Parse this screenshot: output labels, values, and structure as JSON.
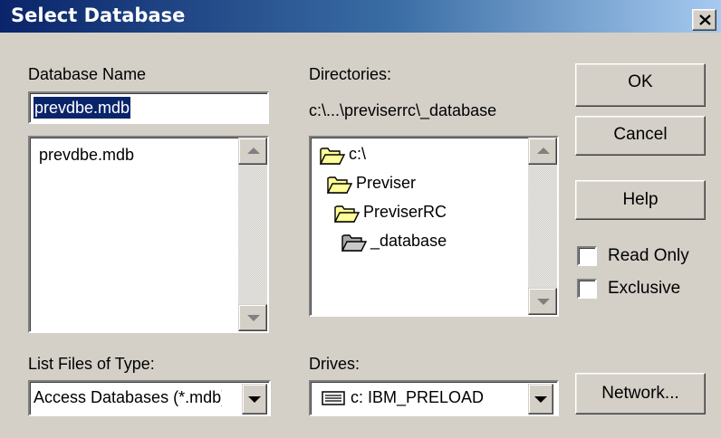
{
  "window": {
    "title": "Select Database",
    "close_symbol": "×"
  },
  "database_name": {
    "label": "Database Name",
    "value": "prevdbe.mdb",
    "files": [
      "prevdbe.mdb"
    ]
  },
  "directories": {
    "label": "Directories:",
    "current_path": "c:\\...\\previserrc\\_database",
    "items": [
      {
        "name": "c:\\",
        "icon": "open-folder-icon"
      },
      {
        "name": "Previser",
        "icon": "open-folder-icon"
      },
      {
        "name": "PreviserRC",
        "icon": "open-folder-icon"
      },
      {
        "name": "_database",
        "icon": "open-folder-icon"
      }
    ]
  },
  "file_type": {
    "label": "List Files of Type:",
    "value": "Access Databases (*.mdb)"
  },
  "drives": {
    "label": "Drives:",
    "value": "c: IBM_PRELOAD",
    "icon": "hard-drive-icon"
  },
  "buttons": {
    "ok": "OK",
    "cancel": "Cancel",
    "help": "Help",
    "network": "Network..."
  },
  "options": {
    "read_only": {
      "label": "Read Only",
      "checked": false
    },
    "exclusive": {
      "label": "Exclusive",
      "checked": false
    }
  },
  "colors": {
    "title_bar": "#0a246a",
    "selection": "#0a246a",
    "dialog_bg": "#d4d0c8",
    "folder": "#ffff99"
  }
}
